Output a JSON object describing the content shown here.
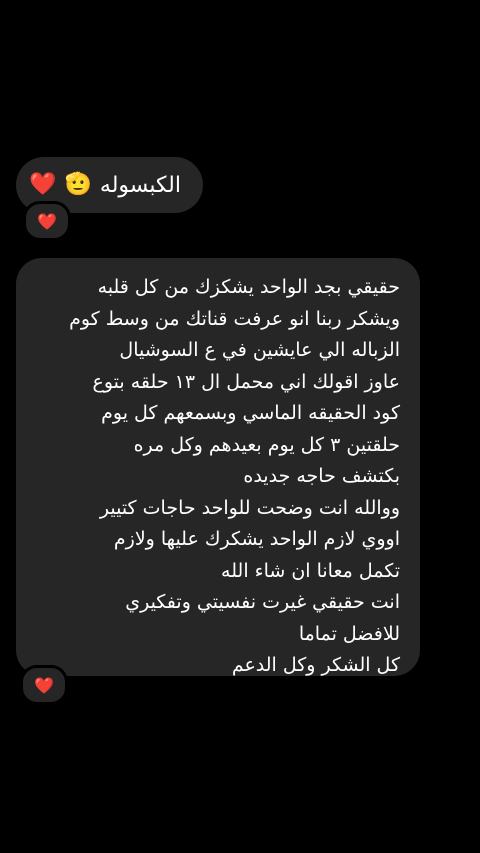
{
  "message_1": {
    "text": "الكبسوله",
    "emojis": [
      "🫡",
      "❤️"
    ]
  },
  "message_1_reaction": "❤️",
  "message_2": {
    "lines": [
      "حقيقي بجد الواحد يشكزك من كل قلبه",
      "ويشكر ربنا انو عرفت قناتك من وسط كوم",
      "الزباله الي عايشين في ع السوشيال",
      "عاوز اقولك اني محمل ال ١٣ حلقه بتوع",
      "كود الحقيقه الماسي وبسمعهم كل يوم",
      "حلقتين ٣ كل يوم بعيدهم وكل مره",
      "بكتشف حاجه جديده",
      "ووالله انت وضحت للواحد حاجات كتيير",
      "اووي لازم الواحد يشكرك عليها ولازم",
      "تكمل معانا ان شاء الله",
      "انت حقيقي غيرت نفسيتي وتفكيري",
      "للافضل تماما",
      "كل الشكر وكل الدعم"
    ]
  },
  "message_2_reaction": "❤️"
}
